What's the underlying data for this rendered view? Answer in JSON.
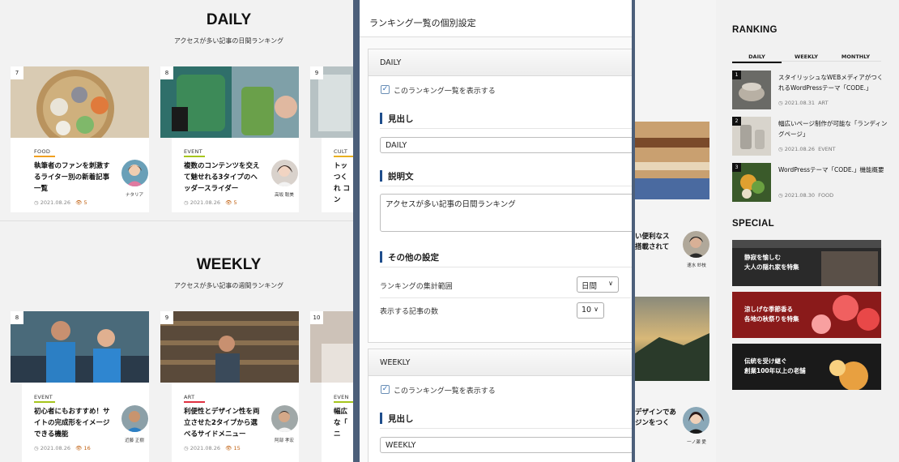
{
  "daily": {
    "title": "DAILY",
    "subtitle": "アクセスが多い記事の日間ランキング",
    "cards": [
      {
        "rank": "7",
        "category": "FOOD",
        "cat_color": "#f0a020",
        "title": "執筆者のファンを刺激するライター別の新着記事一覧",
        "author": "ナタリア",
        "date": "2021.08.26",
        "views": "5"
      },
      {
        "rank": "8",
        "category": "EVENT",
        "cat_color": "#a6c51c",
        "title": "複数のコンテンツを交えて魅せれる3タイプのヘッダースライダー",
        "author": "高坂 聡美",
        "date": "2021.08.26",
        "views": "5"
      },
      {
        "rank": "9",
        "category": "CULT",
        "cat_color": "#e8b020",
        "title": "トッ つくれ コン",
        "author": "",
        "date": "",
        "views": ""
      }
    ]
  },
  "weekly": {
    "title": "WEEKLY",
    "subtitle": "アクセスが多い記事の週間ランキング",
    "cards": [
      {
        "rank": "8",
        "category": "EVENT",
        "cat_color": "#a6c51c",
        "title": "初心者にもおすすめ！サイトの完成形をイメージできる機能",
        "author": "近藤 正樹",
        "date": "2021.08.26",
        "views": "16"
      },
      {
        "rank": "9",
        "category": "ART",
        "cat_color": "#e03040",
        "title": "利便性とデザイン性を両立させた2タイプから選べるサイドメニュー",
        "author": "阿部 孝宏",
        "date": "2021.08.26",
        "views": "15"
      },
      {
        "rank": "10",
        "category": "EVEN",
        "cat_color": "#a6c51c",
        "title": "幅広 な「 ニ",
        "author": "",
        "date": "",
        "views": ""
      }
    ]
  },
  "panel": {
    "title": "ランキング一覧の個別設定",
    "daily_box": {
      "header": "DAILY",
      "show_label": "このランキング一覧を表示する",
      "heading_label": "見出し",
      "heading_value": "DAILY",
      "desc_label": "説明文",
      "desc_value": "アクセスが多い記事の日間ランキング",
      "other_label": "その他の設定",
      "range_label": "ランキングの集計範囲",
      "range_value": "日間",
      "count_label": "表示する記事の数",
      "count_value": "10"
    },
    "weekly_box": {
      "header": "WEEKLY",
      "show_label": "このランキング一覧を表示する",
      "heading_label": "見出し",
      "heading_value": "WEEKLY"
    }
  },
  "middle": {
    "text1_line1": "い便利なス",
    "text1_line2": "搭載されて",
    "author1": "速水 紗枝",
    "text2_line1": "デザインであ",
    "text2_line2": "ジンをつく",
    "author2": "一ノ瀬 愛"
  },
  "sidebar": {
    "ranking_title": "RANKING",
    "tabs": [
      "DAILY",
      "WEEKLY",
      "MONTHLY"
    ],
    "items": [
      {
        "num": "1",
        "title": "スタイリッシュなWEBメディアがつくれるWordPressテーマ「CODE.」",
        "date": "2021.08.31",
        "category": "ART"
      },
      {
        "num": "2",
        "title": "幅広いページ制作が可能な「ランディングページ」",
        "date": "2021.08.26",
        "category": "EVENT"
      },
      {
        "num": "3",
        "title": "WordPressテーマ「CODE.」機能概要",
        "date": "2021.08.30",
        "category": "FOOD"
      }
    ],
    "special_title": "SPECIAL",
    "specials": [
      {
        "line1": "静寂を愉しむ",
        "line2": "大人の隠れ家を特集"
      },
      {
        "line1": "涼しげな季節香る",
        "line2": "各地の秋祭りを特集"
      },
      {
        "line1": "伝統を受け継ぐ",
        "line2": "創業100年以上の老舗"
      }
    ]
  }
}
